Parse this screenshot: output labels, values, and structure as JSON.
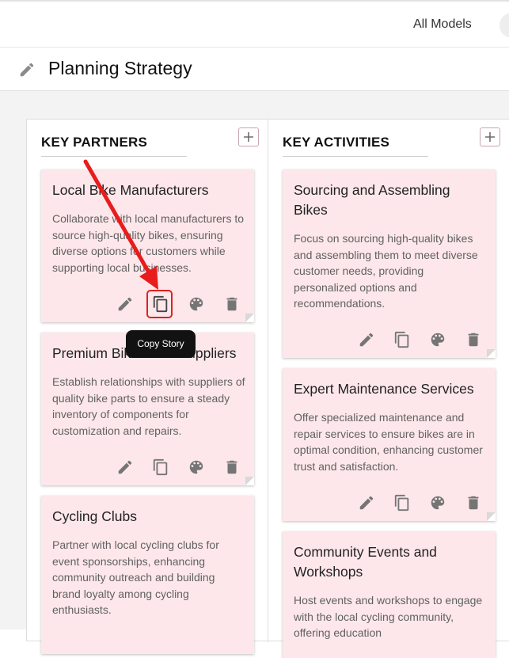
{
  "header": {
    "all_models_label": "All Models"
  },
  "page": {
    "title": "Planning Strategy"
  },
  "columns": [
    {
      "title": "KEY PARTNERS",
      "cards": [
        {
          "title": "Local Bike Manufacturers",
          "description": "Collaborate with local manufacturers to source high-quality bikes, ensuring diverse options for customers while supporting local businesses."
        },
        {
          "title": "Premium Bike Parts Suppliers",
          "description": "Establish relationships with suppliers of quality bike parts to ensure a steady inventory of components for customization and repairs."
        },
        {
          "title": "Cycling Clubs",
          "description": "Partner with local cycling clubs for event sponsorships, enhancing community outreach and building brand loyalty among cycling enthusiasts."
        }
      ]
    },
    {
      "title": "KEY ACTIVITIES",
      "cards": [
        {
          "title": "Sourcing and Assembling Bikes",
          "description": "Focus on sourcing high-quality bikes and assembling them to meet diverse customer needs, providing personalized options and recommendations."
        },
        {
          "title": "Expert Maintenance Services",
          "description": "Offer specialized maintenance and repair services to ensure bikes are in optimal condition, enhancing customer trust and satisfaction."
        },
        {
          "title": "Community Events and Workshops",
          "description": "Host events and workshops to engage with the local cycling community, offering education"
        }
      ]
    }
  ],
  "tooltip": {
    "label": "Copy Story"
  },
  "icons": {
    "edit": "pencil-icon",
    "copy": "copy-icon",
    "color": "palette-icon",
    "delete": "trash-icon",
    "add": "plus-icon"
  },
  "colors": {
    "card_bg": "#fde7ea",
    "highlight": "#e02020",
    "tooltip_bg": "#121212",
    "icon": "#757575"
  }
}
